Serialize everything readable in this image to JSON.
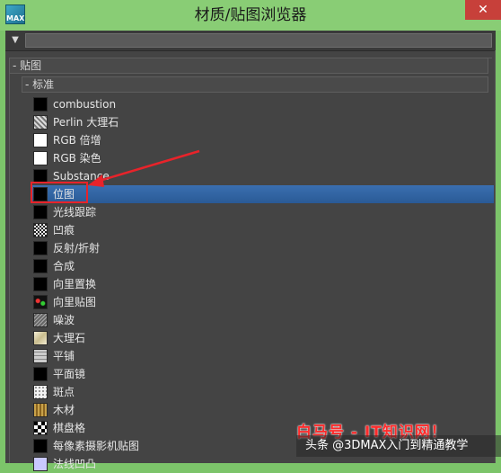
{
  "window": {
    "title": "材质/贴图浏览器",
    "app_icon_text": "MAX",
    "close_glyph": "✕"
  },
  "toolbar": {
    "filter_glyph": "▼",
    "search_value": "",
    "search_placeholder": ""
  },
  "tree": {
    "root_label": "- 贴图",
    "group_label": "- 标准",
    "items": [
      {
        "label": "combustion",
        "thumb": "black"
      },
      {
        "label": "Perlin 大理石",
        "thumb": "perlin"
      },
      {
        "label": "RGB 倍增",
        "thumb": "white"
      },
      {
        "label": "RGB 染色",
        "thumb": "white"
      },
      {
        "label": "Substance",
        "thumb": "black"
      },
      {
        "label": "位图",
        "thumb": "black"
      },
      {
        "label": "光线跟踪",
        "thumb": "black"
      },
      {
        "label": "凹痕",
        "thumb": "dent"
      },
      {
        "label": "反射/折射",
        "thumb": "black"
      },
      {
        "label": "合成",
        "thumb": "black"
      },
      {
        "label": "向里置换",
        "thumb": "black"
      },
      {
        "label": "向里贴图",
        "thumb": "splat"
      },
      {
        "label": "噪波",
        "thumb": "noise"
      },
      {
        "label": "大理石",
        "thumb": "marble"
      },
      {
        "label": "平铺",
        "thumb": "tiles"
      },
      {
        "label": "平面镜",
        "thumb": "black"
      },
      {
        "label": "斑点",
        "thumb": "speckle"
      },
      {
        "label": "木材",
        "thumb": "wood"
      },
      {
        "label": "棋盘格",
        "thumb": "checker"
      },
      {
        "label": "每像素摄影机贴图",
        "thumb": "black"
      },
      {
        "label": "法线凹凸",
        "thumb": "lavender"
      }
    ]
  },
  "selected_index": 5,
  "watermarks": {
    "red_text": "白马号 - IT知识网！",
    "caption": "头条 @3DMAX入门到精通教学"
  },
  "colors": {
    "selection": "#2a5a96",
    "annotation": "#e8232a",
    "panel_bg": "#444444",
    "titlebar": "#89cd75"
  }
}
